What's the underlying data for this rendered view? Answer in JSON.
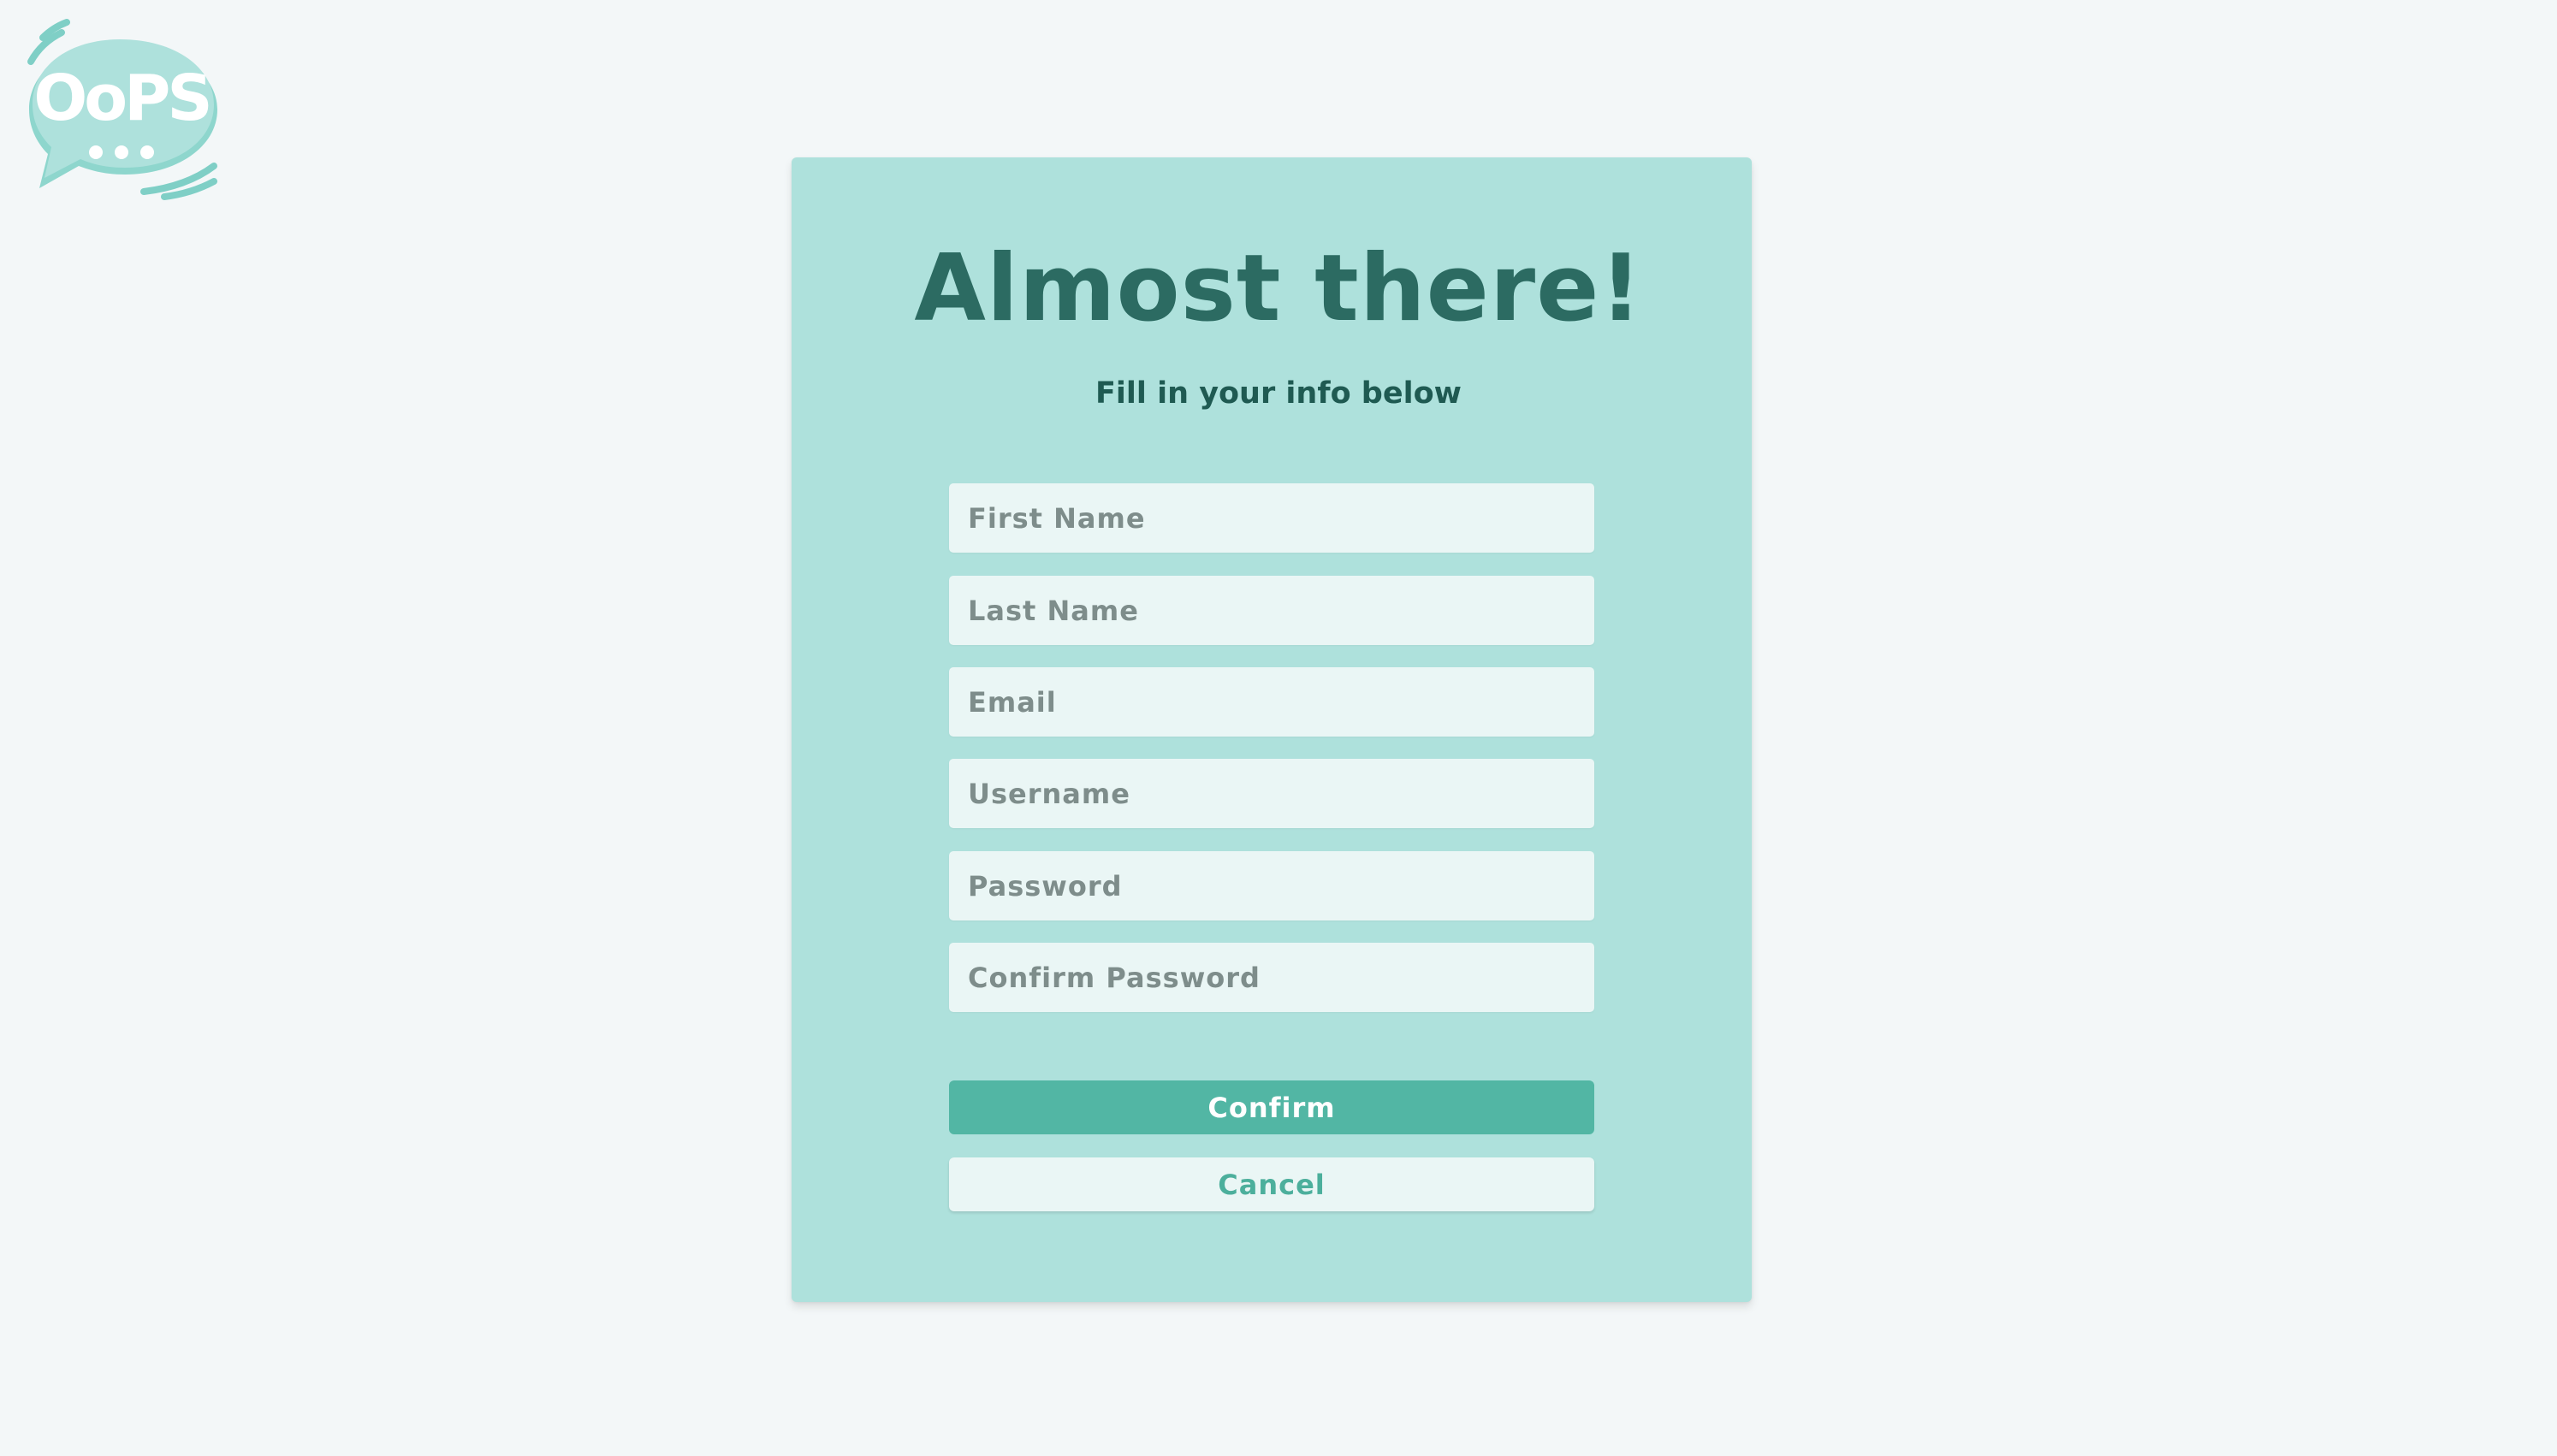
{
  "logo": {
    "text": "OoPS",
    "icon": "speech-bubble-logo-icon"
  },
  "form": {
    "title": "Almost there!",
    "subtitle": "Fill in your info below",
    "fields": {
      "first_name": {
        "placeholder": "First Name",
        "value": ""
      },
      "last_name": {
        "placeholder": "Last Name",
        "value": ""
      },
      "email": {
        "placeholder": "Email",
        "value": ""
      },
      "username": {
        "placeholder": "Username",
        "value": ""
      },
      "password": {
        "placeholder": "Password",
        "value": ""
      },
      "confirm_password": {
        "placeholder": "Confirm Password",
        "value": ""
      }
    },
    "confirm_label": "Confirm",
    "cancel_label": "Cancel"
  },
  "colors": {
    "page_background": "#f3f7f8",
    "card_background": "#aee1dc",
    "title_color": "#2c6b62",
    "input_background": "#eaf6f5",
    "primary_button": "#52b6a4",
    "cancel_text": "#4caf9c"
  }
}
